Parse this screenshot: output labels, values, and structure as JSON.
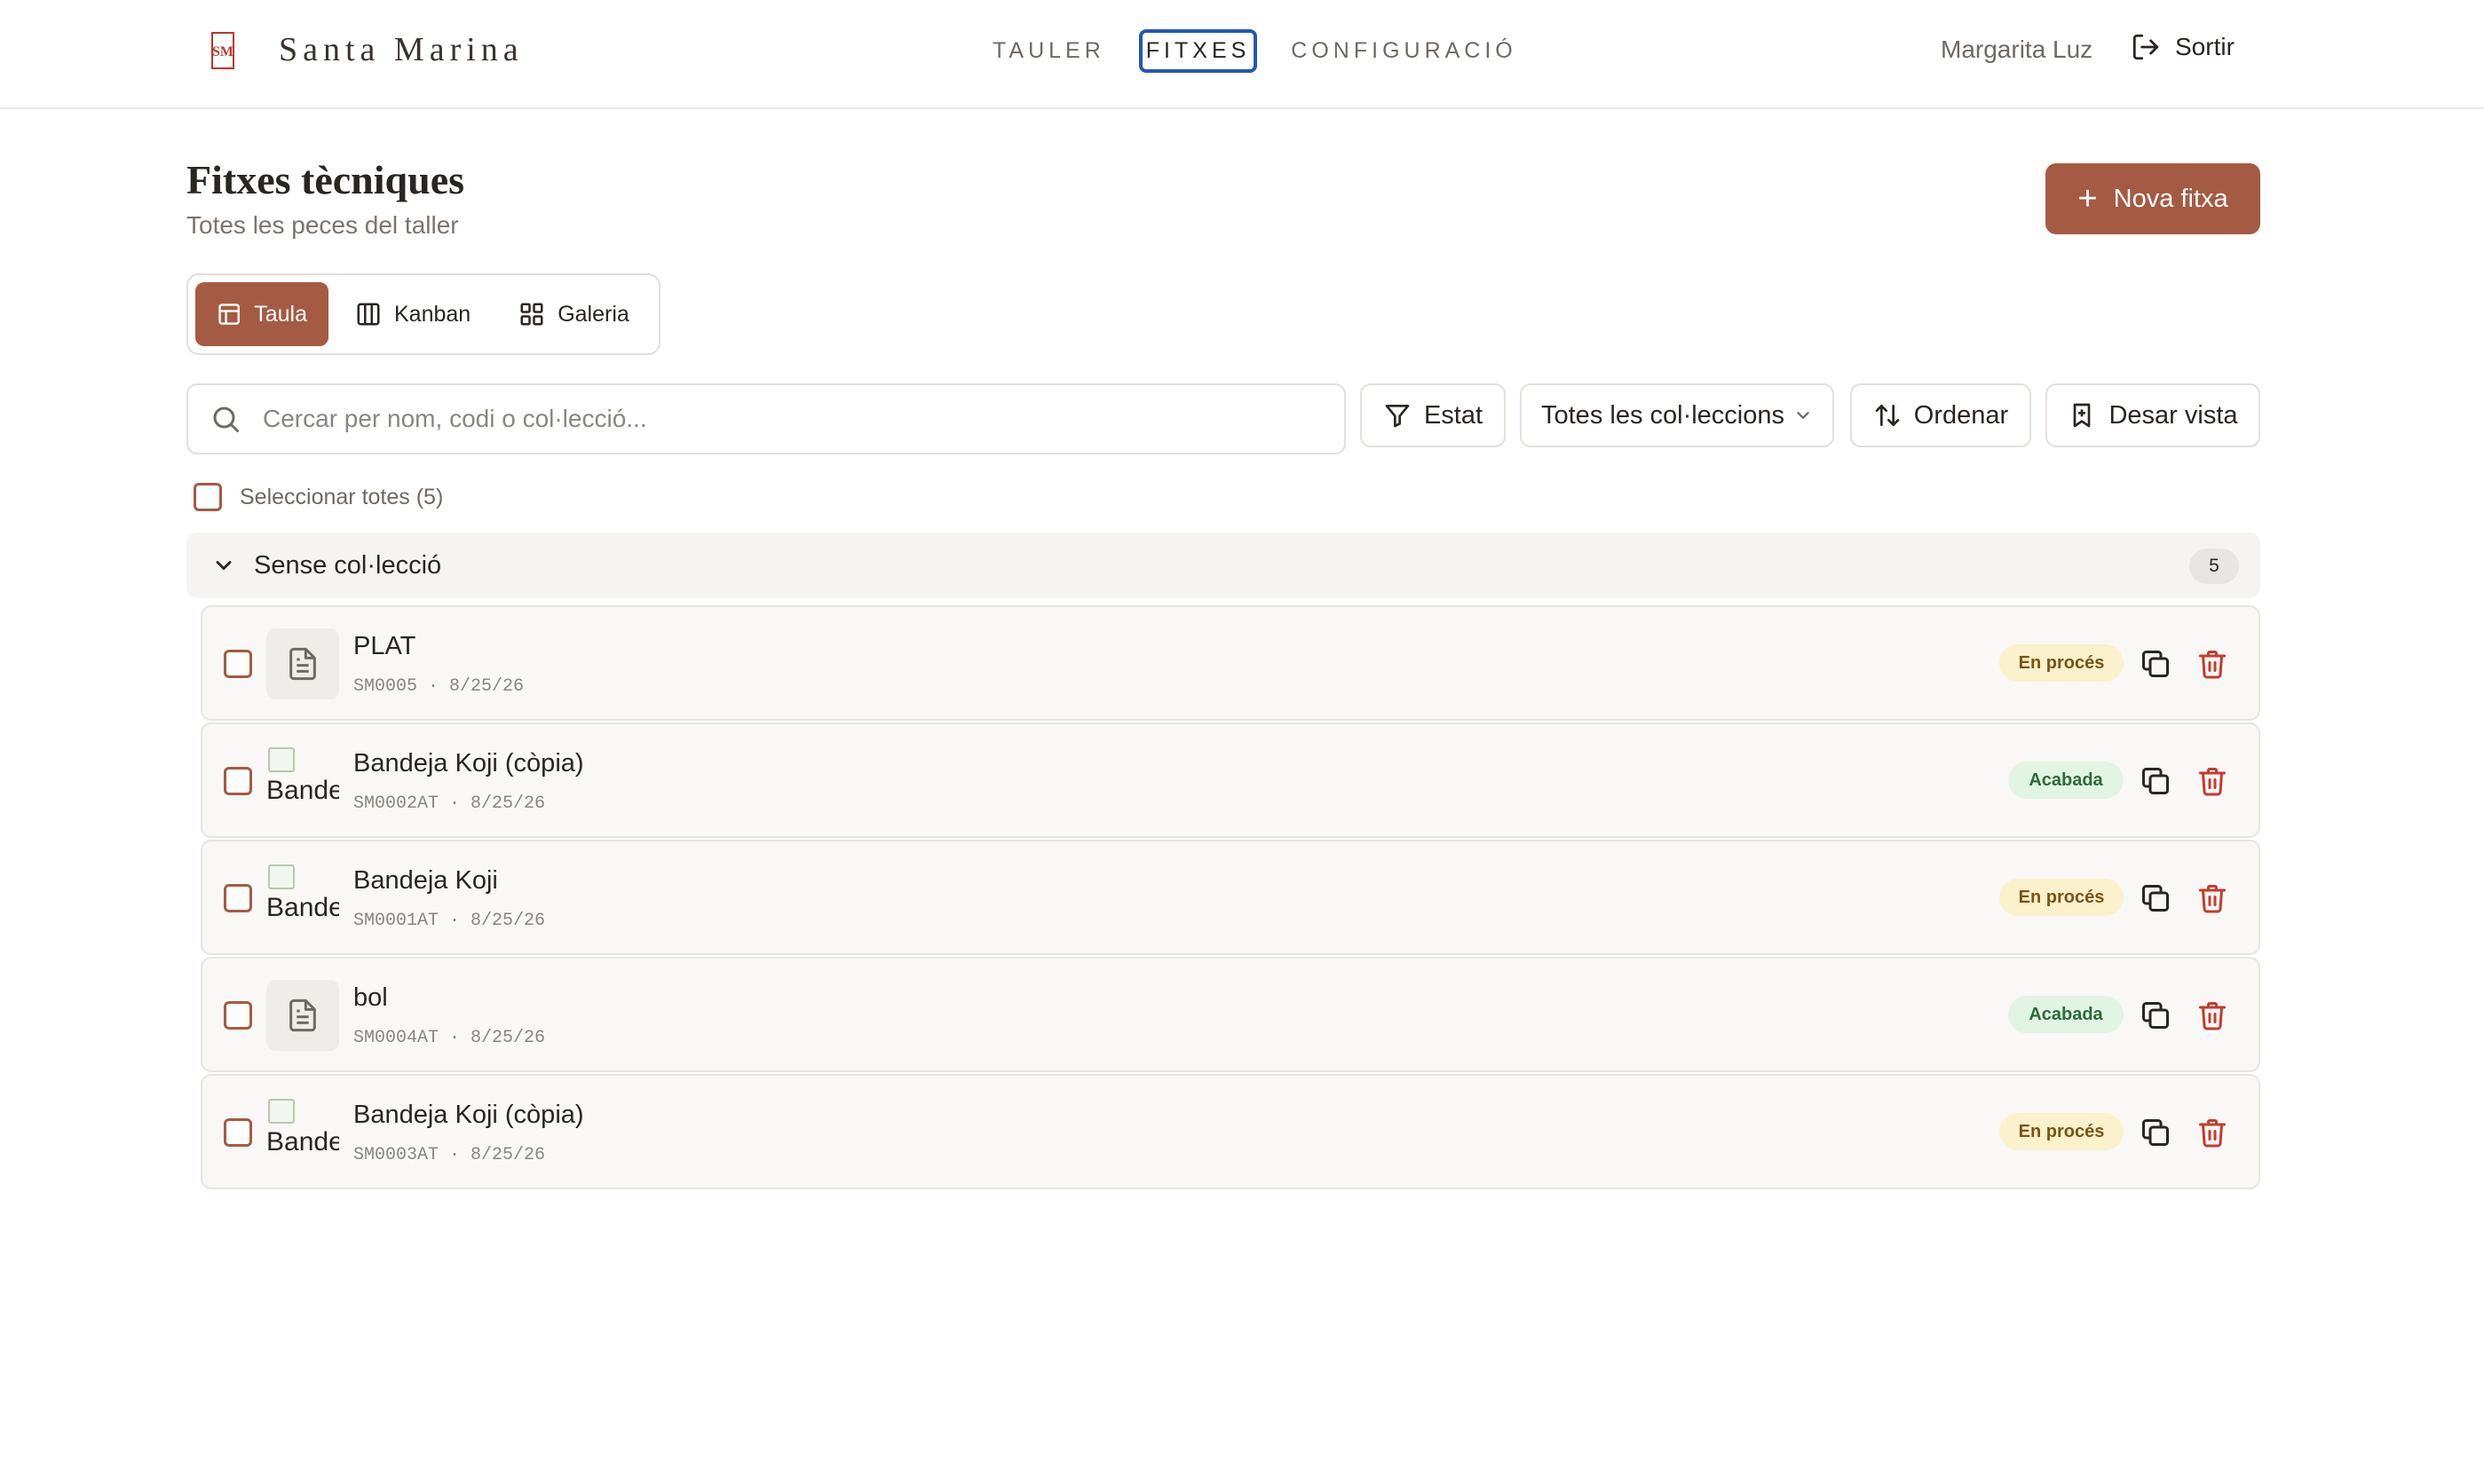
{
  "header": {
    "brand": "Santa Marina",
    "logo_text": "SM",
    "nav": [
      {
        "label": "TAULER"
      },
      {
        "label": "FITXES"
      },
      {
        "label": "CONFIGURACIÓ"
      }
    ],
    "user_name": "Margarita Luz",
    "logout_label": "Sortir"
  },
  "page": {
    "title": "Fitxes tècniques",
    "subtitle": "Totes les peces del taller",
    "new_button": "Nova fitxa"
  },
  "views": [
    {
      "label": "Taula",
      "icon": "table-icon"
    },
    {
      "label": "Kanban",
      "icon": "columns-icon"
    },
    {
      "label": "Galeria",
      "icon": "grid-icon"
    }
  ],
  "toolbar": {
    "search_placeholder": "Cercar per nom, codi o col·lecció...",
    "status_filter": "Estat",
    "collections_select": "Totes les col·leccions",
    "sort": "Ordenar",
    "save_view": "Desar vista"
  },
  "select_all": "Seleccionar totes (5)",
  "group": {
    "label": "Sense col·lecció",
    "count": "5"
  },
  "items": [
    {
      "name": "PLAT",
      "code": "SM0005",
      "date": "8/25/26",
      "status": "En procés",
      "thumb": "document"
    },
    {
      "name": "Bandeja Koji (còpia)",
      "code": "SM0002AT",
      "date": "8/25/26",
      "status": "Acabada",
      "thumb": "image",
      "alt": "Bandeja Koji (còpia)"
    },
    {
      "name": "Bandeja Koji",
      "code": "SM0001AT",
      "date": "8/25/26",
      "status": "En procés",
      "thumb": "image",
      "alt": "Bandeja Koji"
    },
    {
      "name": "bol",
      "code": "SM0004AT",
      "date": "8/25/26",
      "status": "Acabada",
      "thumb": "document"
    },
    {
      "name": "Bandeja Koji (còpia)",
      "code": "SM0003AT",
      "date": "8/25/26",
      "status": "En procés",
      "thumb": "image",
      "alt": "Bandeja Koji (còpia)"
    }
  ],
  "colors": {
    "accent": "#a55a43",
    "focus": "#2456b8",
    "status_in_progress_bg": "#fbf1cc",
    "status_done_bg": "#e2f4e4",
    "delete": "#c43b2f"
  }
}
